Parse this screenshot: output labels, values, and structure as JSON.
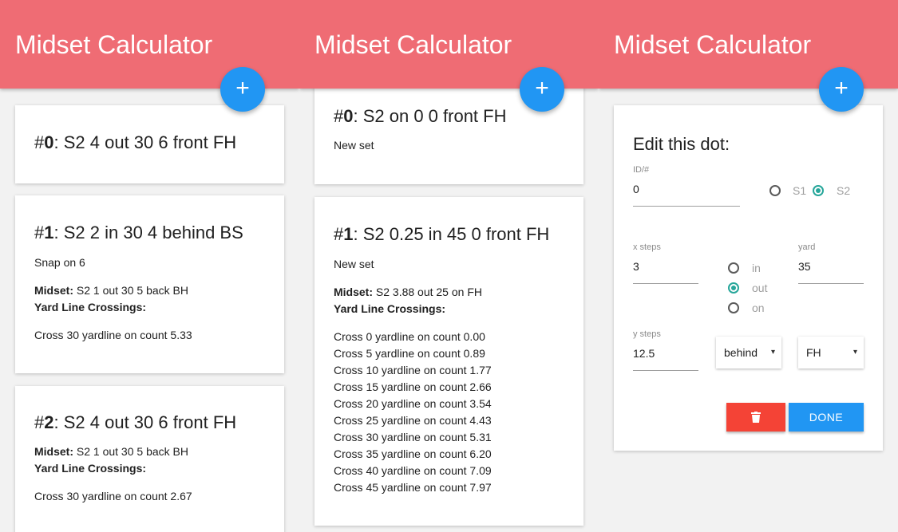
{
  "app": {
    "title": "Midset Calculator",
    "fab_label": "+"
  },
  "panel1": {
    "cards": [
      {
        "hash": "#",
        "id": "0",
        "desc": ": S2 4 out 30 6 front FH"
      },
      {
        "hash": "#",
        "id": "1",
        "desc": ": S2 2 in 30 4 behind BS",
        "note": "Snap on 6",
        "midset_label": "Midset:",
        "midset_value": "S2 1 out 30 5 back BH",
        "crossings_label": "Yard Line Crossings:",
        "crossings": [
          "Cross 30 yardline on count 5.33"
        ]
      },
      {
        "hash": "#",
        "id": "2",
        "desc": ": S2 4 out 30 6 front FH",
        "midset_label": "Midset:",
        "midset_value": "S2 1 out 30 5 back BH",
        "crossings_label": "Yard Line Crossings:",
        "crossings": [
          "Cross 30 yardline on count 2.67"
        ]
      }
    ]
  },
  "panel2": {
    "cards": [
      {
        "hash": "#",
        "id": "0",
        "desc": ": S2 on 0 0 front FH",
        "note": "New set"
      },
      {
        "hash": "#",
        "id": "1",
        "desc": ": S2 0.25 in 45 0 front FH",
        "note": "New set",
        "midset_label": "Midset:",
        "midset_value": "S2 3.88 out 25 on FH",
        "crossings_label": "Yard Line Crossings:",
        "crossings": [
          "Cross 0 yardline on count 0.00",
          "Cross 5 yardline on count 0.89",
          "Cross 10 yardline on count 1.77",
          "Cross 15 yardline on count 2.66",
          "Cross 20 yardline on count 3.54",
          "Cross 25 yardline on count 4.43",
          "Cross 30 yardline on count 5.31",
          "Cross 35 yardline on count 6.20",
          "Cross 40 yardline on count 7.09",
          "Cross 45 yardline on count 7.97"
        ]
      }
    ]
  },
  "edit": {
    "title": "Edit this dot:",
    "id_label": "ID/#",
    "id_value": "0",
    "side_options": [
      "S1",
      "S2"
    ],
    "side_selected": "S2",
    "x_label": "x steps",
    "x_value": "3",
    "direction_options": [
      "in",
      "out",
      "on"
    ],
    "direction_selected": "out",
    "yard_label": "yard",
    "yard_value": "35",
    "y_label": "y steps",
    "y_value": "12.5",
    "relation_value": "behind",
    "hash_value": "FH",
    "caret": "▾",
    "delete_icon": "trash-icon",
    "done_label": "DONE"
  },
  "colors": {
    "appbar": "#ef6c74",
    "fab": "#2196f3",
    "delete": "#f44336",
    "radio_checked": "#26a69a"
  }
}
